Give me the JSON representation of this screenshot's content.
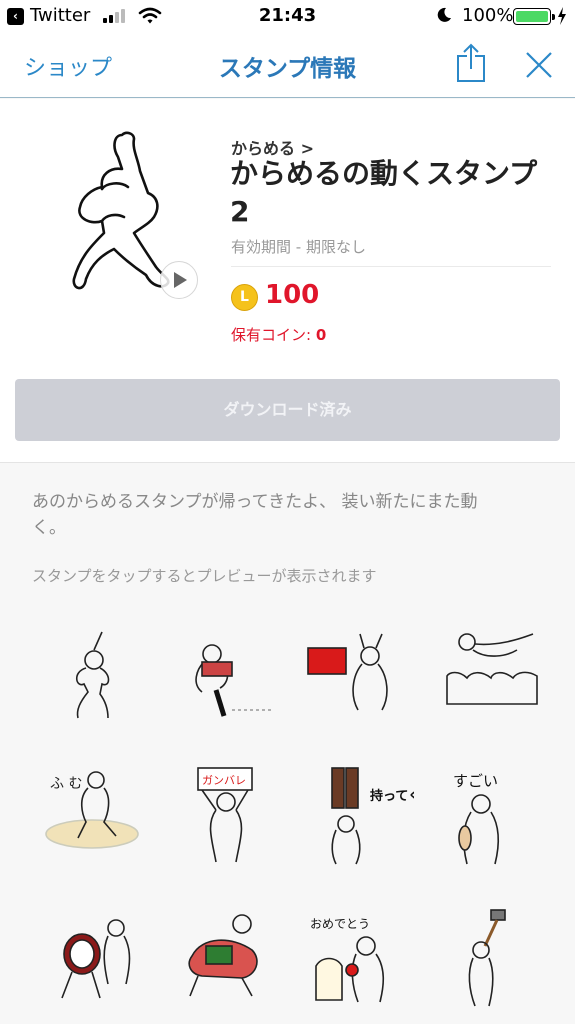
{
  "status_bar": {
    "back_app": "Twitter",
    "time": "21:43",
    "battery": "100%",
    "battery_level": 1.0,
    "signal_bars_filled": 2,
    "signal_bars_total": 4
  },
  "nav": {
    "back_label": "ショップ",
    "title": "スタンプ情報",
    "share_icon": "share-icon",
    "close_icon": "close-icon"
  },
  "product": {
    "author": "からめる >",
    "title": "からめるの動くスタンプ 2",
    "validity": "有効期間 - 期限なし",
    "coin_symbol": "L",
    "price": "100",
    "owned_label": "保有コイン: ",
    "owned_value": "0",
    "download_label": "ダウンロード済み"
  },
  "description": {
    "text": "あのからめるスタンプが帰ってきたよ、 装い新たにまた動く。",
    "hint": "スタンプをタップするとプレビューが表示されます"
  },
  "stickers": [
    {
      "id": "s1",
      "caption": ""
    },
    {
      "id": "s2",
      "caption": ""
    },
    {
      "id": "s3",
      "caption": ""
    },
    {
      "id": "s4",
      "caption": ""
    },
    {
      "id": "s5",
      "caption": "ふ む"
    },
    {
      "id": "s6",
      "caption": "ガンバレ"
    },
    {
      "id": "s7",
      "caption": "持ってくれ"
    },
    {
      "id": "s8",
      "caption": "すごい"
    },
    {
      "id": "s9",
      "caption": ""
    },
    {
      "id": "s10",
      "caption": ""
    },
    {
      "id": "s11",
      "caption": "おめでとう"
    },
    {
      "id": "s12",
      "caption": ""
    }
  ],
  "colors": {
    "accent_blue": "#2b78b8",
    "price_red": "#e0162b",
    "coin_gold": "#f5c21b",
    "disabled_button": "#cdcfd6",
    "battery_green": "#4cd964"
  }
}
